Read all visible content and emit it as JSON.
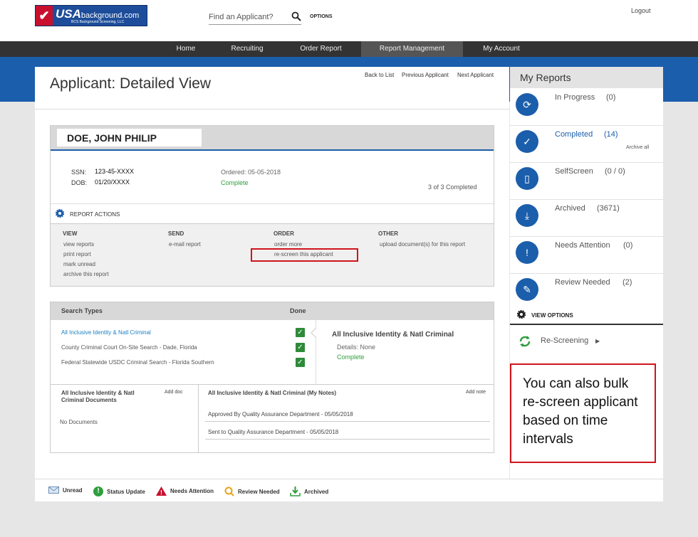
{
  "header": {
    "logo_main": "USA",
    "logo_suffix": "background.com",
    "logo_sub": "BCS Background Screening, LLC",
    "search_placeholder": "Find an Applicant?",
    "options_label": "OPTIONS",
    "logout_label": "Logout"
  },
  "nav": {
    "items": [
      {
        "label": "Home"
      },
      {
        "label": "Recruiting"
      },
      {
        "label": "Order Report"
      },
      {
        "label": "Report Management",
        "active": true
      },
      {
        "label": "My Account"
      }
    ]
  },
  "page": {
    "title": "Applicant: Detailed View",
    "back_to_list": "Back to List",
    "previous": "Previous Applicant",
    "next": "Next Applicant"
  },
  "applicant": {
    "name": "DOE, JOHN PHILIP",
    "ssn_label": "SSN:",
    "ssn": "123-45-XXXX",
    "dob_label": "DOB:",
    "dob": "01/20/XXXX",
    "ordered": "Ordered: 05-05-2018",
    "status": "Complete",
    "completed_count": "3 of 3 Completed"
  },
  "report_actions": {
    "title": "REPORT ACTIONS",
    "view": {
      "heading": "VIEW",
      "items": [
        "view reports",
        "print report",
        "mark unread",
        "archive this report"
      ]
    },
    "send": {
      "heading": "SEND",
      "items": [
        "e-mail report"
      ]
    },
    "order": {
      "heading": "ORDER",
      "items": [
        "order more",
        "re-screen this applicant"
      ]
    },
    "other": {
      "heading": "OTHER",
      "items": [
        "upload document(s) for this report"
      ]
    }
  },
  "searches": {
    "col_search_types": "Search Types",
    "col_done": "Done",
    "rows": [
      {
        "name": "All Inclusive Identity & Natl Criminal",
        "done": true,
        "selected": true
      },
      {
        "name": "County Criminal Court On-Site Search - Dade, Florida",
        "done": true
      },
      {
        "name": "Federal Statewide USDC Criminal Search - Florida Southern",
        "done": true
      }
    ],
    "detail_title": "All Inclusive Identity & Natl Criminal",
    "detail_details": "Details: None",
    "detail_status": "Complete"
  },
  "documents": {
    "title_line1": "All Inclusive Identity & Natl",
    "title_line2": "Criminal Documents",
    "add_doc": "Add doc",
    "empty": "No Documents"
  },
  "notes": {
    "title": "All Inclusive Identity & Natl Criminal (My Notes)",
    "add_note": "Add note",
    "items": [
      "Approved By Quality Assurance Department - 05/05/2018",
      "Sent to Quality Assurance Department - 05/05/2018"
    ]
  },
  "my_reports": {
    "title": "My Reports",
    "items": [
      {
        "label": "In Progress",
        "count": "(0)"
      },
      {
        "label": "Completed",
        "count": "(14)",
        "extra": "Archive all"
      },
      {
        "label": "SelfScreen",
        "count": "(0 / 0)"
      },
      {
        "label": "Archived",
        "count": "(3671)"
      },
      {
        "label": "Needs Attention",
        "count": "(0)"
      },
      {
        "label": "Review Needed",
        "count": "(2)"
      }
    ],
    "view_options": "VIEW OPTIONS",
    "rescreening": "Re-Screening"
  },
  "callout": {
    "text": "You can also bulk re-screen applicant based on time intervals"
  },
  "legend": {
    "items": [
      {
        "label": "Unread"
      },
      {
        "label": "Status Update"
      },
      {
        "label": "Needs Attention"
      },
      {
        "label": "Review Needed"
      },
      {
        "label": "Archived"
      }
    ]
  },
  "colors": {
    "brand_blue": "#1b5eab",
    "nav_dark": "#333333",
    "highlight_red": "#d0141c",
    "success_green": "#2e9e3d"
  }
}
